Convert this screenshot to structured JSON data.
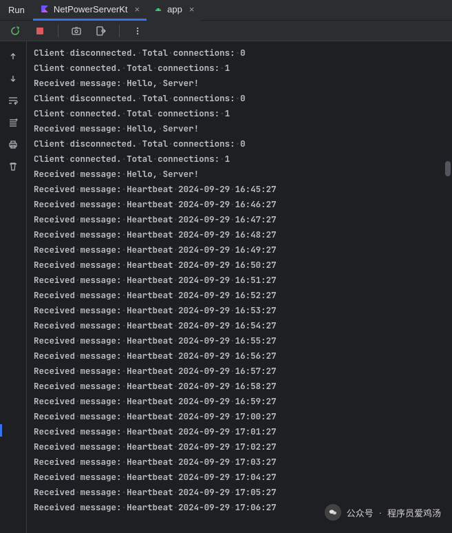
{
  "toolbar": {
    "run_label": "Run",
    "tabs": [
      {
        "label": "NetPowerServerKt",
        "icon": "kotlin"
      },
      {
        "label": "app",
        "icon": "android"
      }
    ]
  },
  "console": {
    "lines": [
      [
        "Client",
        "disconnected.",
        "Total",
        "connections:",
        "0"
      ],
      [
        "Client",
        "connected.",
        "Total",
        "connections:",
        "1"
      ],
      [
        "Received",
        "message:",
        "Hello,",
        "Server!"
      ],
      [
        "Client",
        "disconnected.",
        "Total",
        "connections:",
        "0"
      ],
      [
        "Client",
        "connected.",
        "Total",
        "connections:",
        "1"
      ],
      [
        "Received",
        "message:",
        "Hello,",
        "Server!"
      ],
      [
        "Client",
        "disconnected.",
        "Total",
        "connections:",
        "0"
      ],
      [
        "Client",
        "connected.",
        "Total",
        "connections:",
        "1"
      ],
      [
        "Received",
        "message:",
        "Hello,",
        "Server!"
      ],
      [
        "Received",
        "message:",
        "Heartbeat",
        "2024-09-29",
        "16:45:27"
      ],
      [
        "Received",
        "message:",
        "Heartbeat",
        "2024-09-29",
        "16:46:27"
      ],
      [
        "Received",
        "message:",
        "Heartbeat",
        "2024-09-29",
        "16:47:27"
      ],
      [
        "Received",
        "message:",
        "Heartbeat",
        "2024-09-29",
        "16:48:27"
      ],
      [
        "Received",
        "message:",
        "Heartbeat",
        "2024-09-29",
        "16:49:27"
      ],
      [
        "Received",
        "message:",
        "Heartbeat",
        "2024-09-29",
        "16:50:27"
      ],
      [
        "Received",
        "message:",
        "Heartbeat",
        "2024-09-29",
        "16:51:27"
      ],
      [
        "Received",
        "message:",
        "Heartbeat",
        "2024-09-29",
        "16:52:27"
      ],
      [
        "Received",
        "message:",
        "Heartbeat",
        "2024-09-29",
        "16:53:27"
      ],
      [
        "Received",
        "message:",
        "Heartbeat",
        "2024-09-29",
        "16:54:27"
      ],
      [
        "Received",
        "message:",
        "Heartbeat",
        "2024-09-29",
        "16:55:27"
      ],
      [
        "Received",
        "message:",
        "Heartbeat",
        "2024-09-29",
        "16:56:27"
      ],
      [
        "Received",
        "message:",
        "Heartbeat",
        "2024-09-29",
        "16:57:27"
      ],
      [
        "Received",
        "message:",
        "Heartbeat",
        "2024-09-29",
        "16:58:27"
      ],
      [
        "Received",
        "message:",
        "Heartbeat",
        "2024-09-29",
        "16:59:27"
      ],
      [
        "Received",
        "message:",
        "Heartbeat",
        "2024-09-29",
        "17:00:27"
      ],
      [
        "Received",
        "message:",
        "Heartbeat",
        "2024-09-29",
        "17:01:27"
      ],
      [
        "Received",
        "message:",
        "Heartbeat",
        "2024-09-29",
        "17:02:27"
      ],
      [
        "Received",
        "message:",
        "Heartbeat",
        "2024-09-29",
        "17:03:27"
      ],
      [
        "Received",
        "message:",
        "Heartbeat",
        "2024-09-29",
        "17:04:27"
      ],
      [
        "Received",
        "message:",
        "Heartbeat",
        "2024-09-29",
        "17:05:27"
      ],
      [
        "Received",
        "message:",
        "Heartbeat",
        "2024-09-29",
        "17:06:27"
      ]
    ]
  },
  "watermark": {
    "prefix": "公众号",
    "sep": "·",
    "name": "程序员爱鸡汤"
  }
}
